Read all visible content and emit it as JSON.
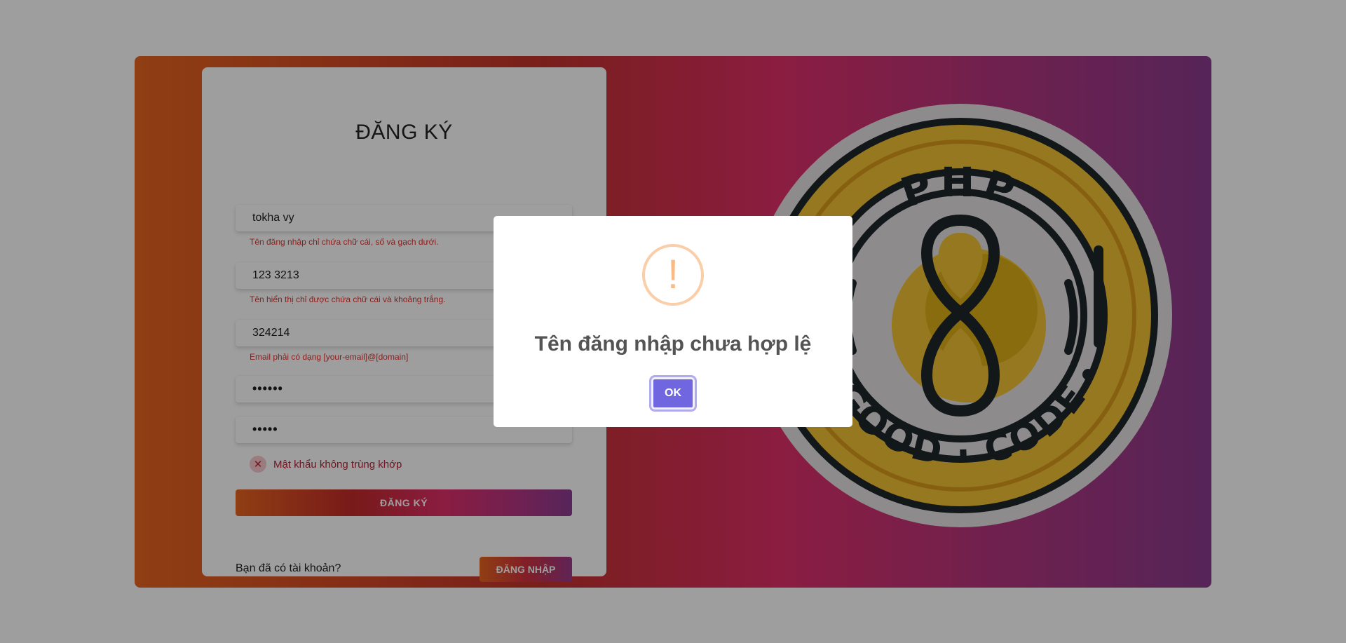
{
  "colors": {
    "accent_orange": "#e8651f",
    "accent_pink": "#e02f6a",
    "accent_purple": "#8a3b8e",
    "error_red": "#e0332f",
    "modal_button": "#7066e0",
    "warning_icon": "#f8bb86"
  },
  "form": {
    "title": "ĐĂNG KÝ",
    "username_value": "tokha vy",
    "username_error": "Tên đăng nhập chỉ chứa chữ cái, số và gạch dưới.",
    "display_name_value": "123 3213",
    "display_name_error": "Tên hiển thị chỉ được chứa chữ cái và khoảng trắng.",
    "email_value": "324214",
    "email_error": "Email phải có dạng [your-email]@[domain]",
    "password_value": "••••••",
    "confirm_password_value": "•••••",
    "password_mismatch": "Mật khẩu không trùng khớp",
    "mismatch_icon": "close-icon",
    "submit_label": "ĐĂNG KÝ",
    "have_account_text": "Bạn đã có tài khoản?",
    "login_label": "ĐĂNG NHẬP"
  },
  "logo": {
    "top_text": "PHP",
    "bottom_text": "GOOD · CODE"
  },
  "modal": {
    "icon": "warning-icon",
    "icon_glyph": "!",
    "title": "Tên đăng nhập chưa hợp lệ",
    "ok_label": "OK"
  }
}
